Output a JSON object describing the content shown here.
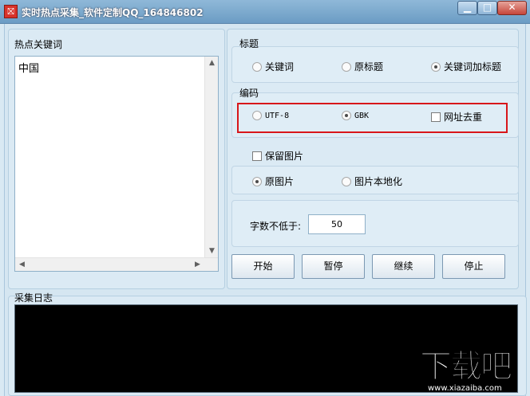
{
  "window": {
    "title": "实时热点采集_软件定制QQ_164846802",
    "icon": "app-logo-icon",
    "controls": {
      "minimize": "▁",
      "maximize": "□",
      "close": "✕"
    }
  },
  "keywords": {
    "label": "热点关键词",
    "items": [
      "中国"
    ]
  },
  "title_group": {
    "label": "标题",
    "options": [
      {
        "label": "关键词",
        "selected": false
      },
      {
        "label": "原标题",
        "selected": false
      },
      {
        "label": "关键词加标题",
        "selected": true
      }
    ]
  },
  "encoding_group": {
    "label": "编码",
    "options": [
      {
        "label": "UTF-8",
        "selected": false
      },
      {
        "label": "GBK",
        "selected": true
      }
    ],
    "dedupe_url": {
      "label": "网址去重",
      "checked": false
    }
  },
  "keep_images": {
    "label": "保留图片",
    "checked": false
  },
  "image_group": {
    "options": [
      {
        "label": "原图片",
        "selected": true
      },
      {
        "label": "图片本地化",
        "selected": false
      }
    ]
  },
  "min_words": {
    "label": "字数不低于:",
    "value": "50"
  },
  "buttons": {
    "start": "开始",
    "pause": "暂停",
    "resume": "继续",
    "stop": "停止"
  },
  "log": {
    "label": "采集日志"
  },
  "watermark": {
    "brand": "下载吧",
    "url": "www.xiazaiba.com"
  },
  "colors": {
    "highlight": "#d8161a",
    "console": "#000000",
    "titlebar": "#7aa7cc"
  }
}
